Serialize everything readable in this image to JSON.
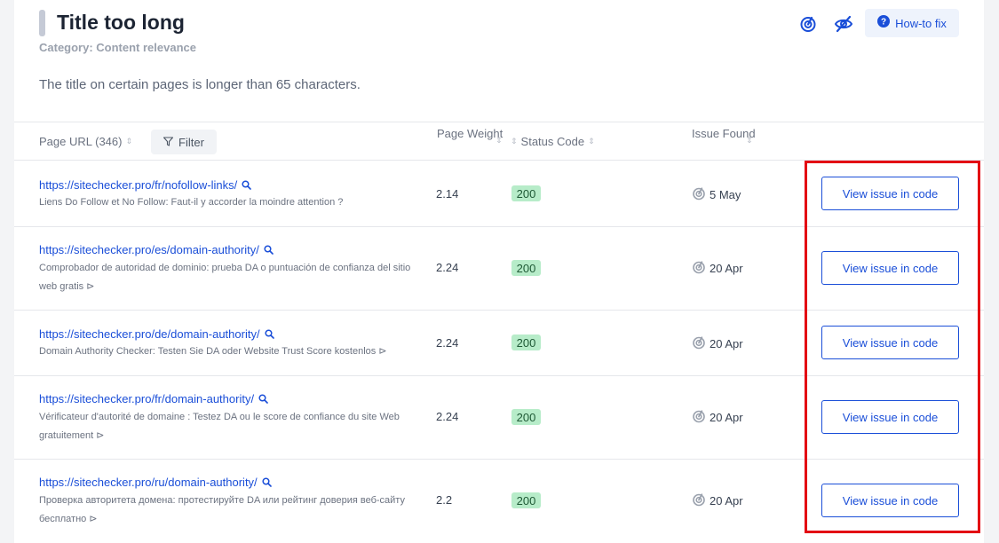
{
  "issue": {
    "title": "Title too long",
    "category": "Category: Content relevance",
    "description": "The title on certain pages is longer than 65 characters.",
    "howto_label": "How-to fix"
  },
  "columns": {
    "url": "Page URL (346)",
    "filter": "Filter",
    "weight": "Page Weight",
    "status": "Status Code",
    "issue_found": "Issue Found"
  },
  "rows": [
    {
      "url": "https://sitechecker.pro/fr/nofollow-links/",
      "title": "Liens Do Follow et No Follow: Faut-il y accorder la moindre attention ?",
      "weight": "2.14",
      "status": "200",
      "date": "5 May",
      "action": "View issue in code"
    },
    {
      "url": "https://sitechecker.pro/es/domain-authority/",
      "title": "Comprobador de autoridad de dominio: prueba DA o puntuación de confianza del sitio web gratis ⊳",
      "weight": "2.24",
      "status": "200",
      "date": "20 Apr",
      "action": "View issue in code"
    },
    {
      "url": "https://sitechecker.pro/de/domain-authority/",
      "title": "Domain Authority Checker: Testen Sie DA oder Website Trust Score kostenlos ⊳",
      "weight": "2.24",
      "status": "200",
      "date": "20 Apr",
      "action": "View issue in code"
    },
    {
      "url": "https://sitechecker.pro/fr/domain-authority/",
      "title": "Vérificateur d'autorité de domaine : Testez DA ou le score de confiance du site Web gratuitement ⊳",
      "weight": "2.24",
      "status": "200",
      "date": "20 Apr",
      "action": "View issue in code"
    },
    {
      "url": "https://sitechecker.pro/ru/domain-authority/",
      "title": "Проверка авторитета домена: протестируйте DA или рейтинг доверия веб-сайту бесплатно ⊳",
      "weight": "2.2",
      "status": "200",
      "date": "20 Apr",
      "action": "View issue in code"
    }
  ],
  "icons": {
    "monitor": "monitor-icon",
    "hide": "eye-off-icon",
    "help": "question-circle-icon",
    "filter": "funnel-icon",
    "search": "search-icon",
    "date": "monitor-icon"
  },
  "colors": {
    "accent": "#1a4ed8",
    "status_ok_bg": "#b7ecc9",
    "highlight": "#e30613"
  }
}
